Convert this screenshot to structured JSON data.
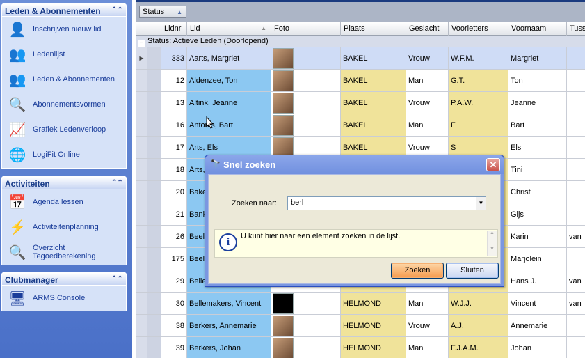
{
  "sidebar": {
    "panels": [
      {
        "title": "Leden & Abonnementen",
        "items": [
          {
            "label": "Inschrijven nieuw lid",
            "icon": "add-user-icon"
          },
          {
            "label": "Ledenlijst",
            "icon": "users-icon"
          },
          {
            "label": "Leden & Abonnementen",
            "icon": "user-search-icon"
          },
          {
            "label": "Abonnementsvormen",
            "icon": "magnifier-icon"
          },
          {
            "label": "Grafiek Ledenverloop",
            "icon": "chart-icon"
          },
          {
            "label": "LogiFit Online",
            "icon": "globe-icon"
          }
        ]
      },
      {
        "title": "Activiteiten",
        "items": [
          {
            "label": "Agenda lessen",
            "icon": "calendar-icon"
          },
          {
            "label": "Activiteitenplanning",
            "icon": "lightning-icon"
          },
          {
            "label": "Overzicht Tegoedberekening",
            "icon": "magnifier-icon"
          }
        ]
      },
      {
        "title": "Clubmanager",
        "items": [
          {
            "label": "ARMS Console",
            "icon": "console-icon"
          }
        ]
      }
    ]
  },
  "grid": {
    "group_button": "Status",
    "columns": [
      "Lidnr",
      "Lid",
      "Foto",
      "Plaats",
      "Geslacht",
      "Voorletters",
      "Voornaam",
      "Tuss"
    ],
    "group_row": "Status:   Actieve Leden (Doorlopend)",
    "rows": [
      {
        "nr": "333",
        "lid": "Aarts, Margriet",
        "plaats": "BAKEL",
        "gesl": "Vrouw",
        "vl": "W.F.M.",
        "vn": "Margriet",
        "tus": ""
      },
      {
        "nr": "12",
        "lid": "Aldenzee, Ton",
        "plaats": "BAKEL",
        "gesl": "Man",
        "vl": "G.T.",
        "vn": "Ton",
        "tus": ""
      },
      {
        "nr": "13",
        "lid": "Altink, Jeanne",
        "plaats": "BAKEL",
        "gesl": "Vrouw",
        "vl": "P.A.W.",
        "vn": "Jeanne",
        "tus": ""
      },
      {
        "nr": "16",
        "lid": "Antonis, Bart",
        "plaats": "BAKEL",
        "gesl": "Man",
        "vl": "F",
        "vn": "Bart",
        "tus": ""
      },
      {
        "nr": "17",
        "lid": "Arts, Els",
        "plaats": "BAKEL",
        "gesl": "Vrouw",
        "vl": "S",
        "vn": "Els",
        "tus": ""
      },
      {
        "nr": "18",
        "lid": "Arts,",
        "plaats": "",
        "gesl": "",
        "vl": "",
        "vn": "Tini",
        "tus": ""
      },
      {
        "nr": "20",
        "lid": "Bake",
        "plaats": "",
        "gesl": "",
        "vl": "",
        "vn": "Christ",
        "tus": ""
      },
      {
        "nr": "21",
        "lid": "Bank",
        "plaats": "",
        "gesl": "",
        "vl": "",
        "vn": "Gijs",
        "tus": ""
      },
      {
        "nr": "26",
        "lid": "Beel",
        "plaats": "",
        "gesl": "",
        "vl": "",
        "vn": "Karin",
        "tus": "van"
      },
      {
        "nr": "175",
        "lid": "Beel",
        "plaats": "",
        "gesl": "",
        "vl": "",
        "vn": "Marjolein",
        "tus": ""
      },
      {
        "nr": "29",
        "lid": "Belle",
        "plaats": "",
        "gesl": "",
        "vl": "",
        "vn": "Hans J.",
        "tus": "van"
      },
      {
        "nr": "30",
        "lid": "Bellemakers, Vincent",
        "plaats": "HELMOND",
        "gesl": "Man",
        "vl": "W.J.J.",
        "vn": "Vincent",
        "tus": "van"
      },
      {
        "nr": "38",
        "lid": "Berkers, Annemarie",
        "plaats": "HELMOND",
        "gesl": "Vrouw",
        "vl": "A.J.",
        "vn": "Annemarie",
        "tus": ""
      },
      {
        "nr": "39",
        "lid": "Berkers, Johan",
        "plaats": "HELMOND",
        "gesl": "Man",
        "vl": "F.J.A.M.",
        "vn": "Johan",
        "tus": ""
      }
    ]
  },
  "dialog": {
    "title": "Snel zoeken",
    "search_label": "Zoeken naar:",
    "search_value": "berl",
    "info": "U kunt hier naar een element zoeken in de lijst.",
    "btn_zoeken": "Zoeken",
    "btn_sluiten": "Sluiten"
  }
}
